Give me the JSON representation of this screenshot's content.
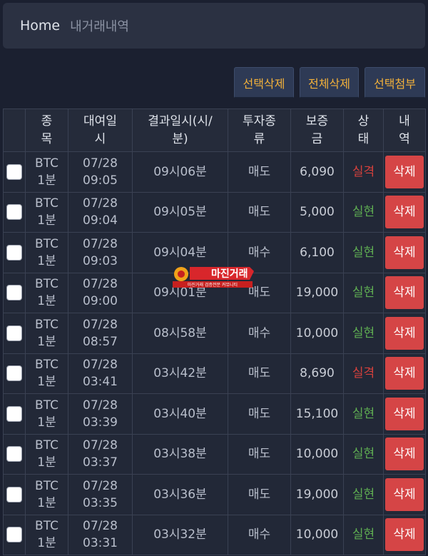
{
  "breadcrumb": {
    "home": "Home",
    "current": "내거래내역"
  },
  "toolbar": {
    "delete_selected": "선택삭제",
    "delete_all": "전체삭제",
    "attach_selected": "선택첨부"
  },
  "table": {
    "headers": {
      "type": "종\n목",
      "date": "대여일\n시",
      "result": "결과일시(시/\n분)",
      "invest": "투자종\n류",
      "deposit": "보증\n금",
      "status": "상\n태",
      "history": "내\n역"
    },
    "rows": [
      {
        "type": "BTC\n1분",
        "date": "07/28\n09:05",
        "result": "09시06분",
        "invest": "매도",
        "deposit": "6,090",
        "status": "실격",
        "action": "삭제"
      },
      {
        "type": "BTC\n1분",
        "date": "07/28\n09:04",
        "result": "09시05분",
        "invest": "매도",
        "deposit": "5,000",
        "status": "실현",
        "action": "삭제"
      },
      {
        "type": "BTC\n1분",
        "date": "07/28\n09:03",
        "result": "09시04분",
        "invest": "매수",
        "deposit": "6,100",
        "status": "실현",
        "action": "삭제"
      },
      {
        "type": "BTC\n1분",
        "date": "07/28\n09:00",
        "result": "09시01분",
        "invest": "매도",
        "deposit": "19,000",
        "status": "실현",
        "action": "삭제"
      },
      {
        "type": "BTC\n1분",
        "date": "07/28\n08:57",
        "result": "08시58분",
        "invest": "매수",
        "deposit": "10,000",
        "status": "실현",
        "action": "삭제"
      },
      {
        "type": "BTC\n1분",
        "date": "07/28\n03:41",
        "result": "03시42분",
        "invest": "매도",
        "deposit": "8,690",
        "status": "실격",
        "action": "삭제"
      },
      {
        "type": "BTC\n1분",
        "date": "07/28\n03:39",
        "result": "03시40분",
        "invest": "매도",
        "deposit": "15,100",
        "status": "실현",
        "action": "삭제"
      },
      {
        "type": "BTC\n1분",
        "date": "07/28\n03:37",
        "result": "03시38분",
        "invest": "매도",
        "deposit": "10,000",
        "status": "실현",
        "action": "삭제"
      },
      {
        "type": "BTC\n1분",
        "date": "07/28\n03:35",
        "result": "03시36분",
        "invest": "매도",
        "deposit": "19,000",
        "status": "실현",
        "action": "삭제"
      },
      {
        "type": "BTC\n1분",
        "date": "07/28\n03:31",
        "result": "03시32분",
        "invest": "매수",
        "deposit": "10,000",
        "status": "실현",
        "action": "삭제"
      }
    ]
  },
  "watermark": {
    "text": "마진거래",
    "subtext": "마진거래 검증전문 커뮤니티"
  },
  "colors": {
    "status_fail": "#d7413c",
    "status_ok": "#5fae52",
    "delete_button": "#d54546",
    "toolbar_text": "#f3b13a"
  }
}
